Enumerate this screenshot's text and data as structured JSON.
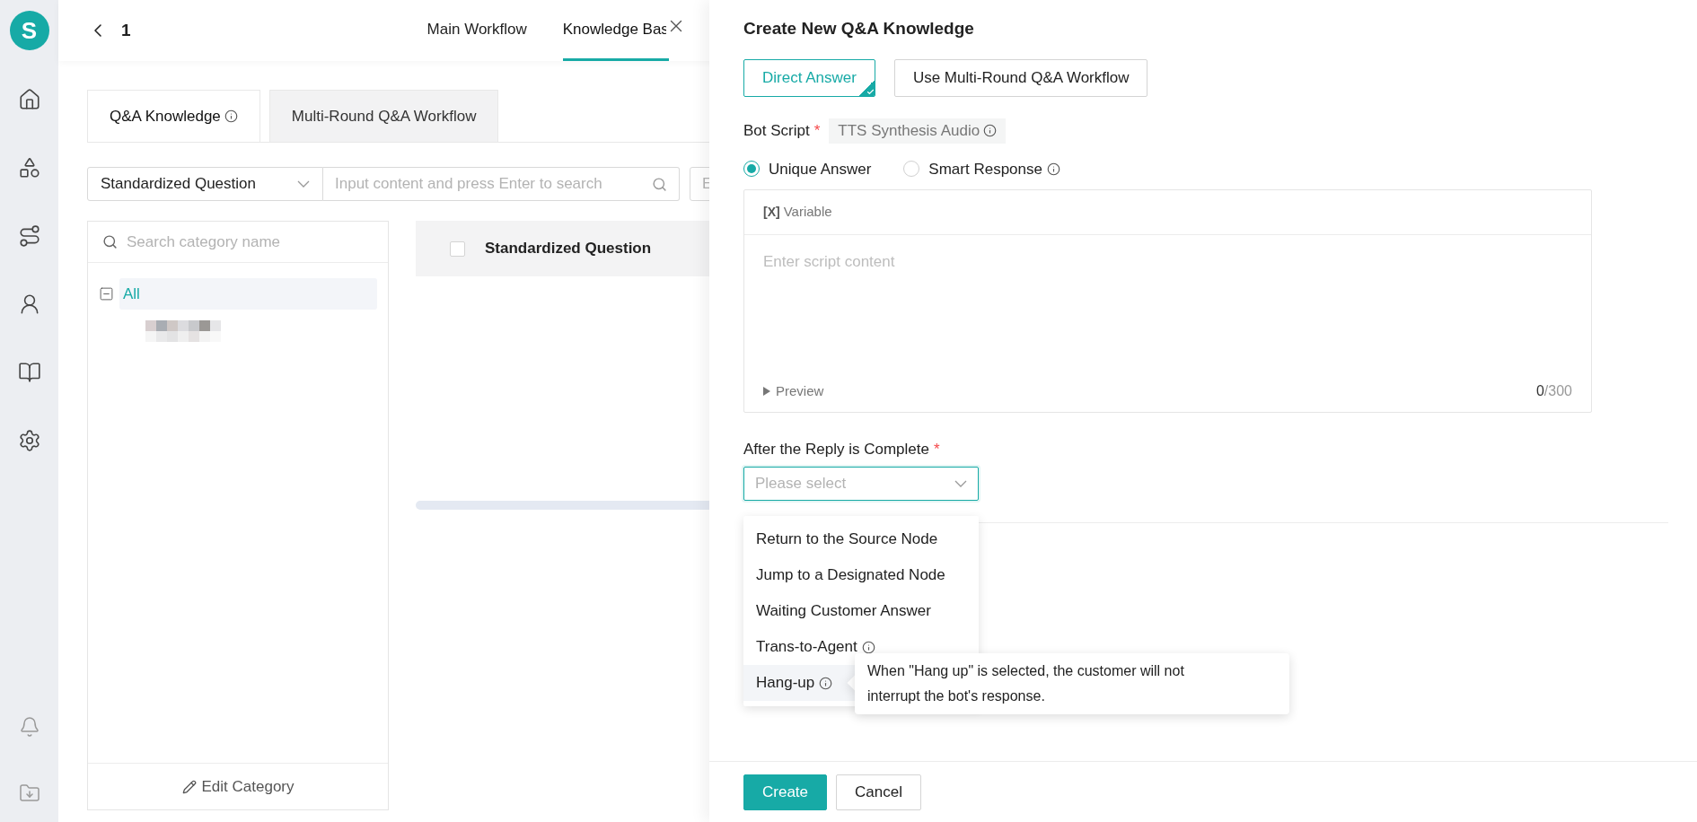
{
  "logo": {
    "letter": "S"
  },
  "header": {
    "back_label": "1",
    "tabs": [
      {
        "label": "Main Workflow",
        "selected": false
      },
      {
        "label": "Knowledge Bas",
        "selected": true
      }
    ]
  },
  "sub_tabs": [
    {
      "label": "Q&A Knowledge",
      "info": true,
      "selected": true
    },
    {
      "label": "Multi-Round Q&A Workflow",
      "info": false,
      "selected": false
    }
  ],
  "filter": {
    "field": "Standardized Question",
    "search_placeholder": "Input content and press Enter to search",
    "column_3": "E"
  },
  "category": {
    "search_placeholder": "Search category name",
    "tree": [
      {
        "label": "All",
        "expanded": true,
        "selected": true,
        "children": [
          {
            "kind": "redacted"
          }
        ]
      }
    ],
    "edit_label": "Edit Category"
  },
  "table": {
    "columns": [
      "Standardized Question"
    ],
    "select_all_checked": false
  },
  "drawer": {
    "title": "Create New Q&A Knowledge",
    "answer_types": [
      {
        "label": "Direct Answer",
        "selected": true
      },
      {
        "label": "Use Multi-Round Q&A Workflow",
        "selected": false
      }
    ],
    "bot_script": {
      "label": "Bot Script",
      "required_mark": "*",
      "tag": "TTS Synthesis Audio"
    },
    "answer_modes": [
      {
        "label": "Unique Answer",
        "info": false,
        "selected": true
      },
      {
        "label": "Smart Response",
        "info": true,
        "selected": false
      }
    ],
    "editor": {
      "toolbar_icon": "[X]",
      "toolbar": "Variable",
      "placeholder": "Enter script content",
      "preview": "Preview",
      "count": "0",
      "max": "/300"
    },
    "after_reply": {
      "label": "After the Reply is Complete",
      "required_mark": "*",
      "placeholder": "Please select",
      "options": [
        {
          "label": "Return to the Source Node",
          "info": false,
          "hovered": false
        },
        {
          "label": "Jump to a Designated Node",
          "info": false,
          "hovered": false
        },
        {
          "label": "Waiting Customer Answer",
          "info": false,
          "hovered": false
        },
        {
          "label": "Trans-to-Agent",
          "info": true,
          "hovered": false
        },
        {
          "label": "Hang-up",
          "info": true,
          "hovered": true
        }
      ]
    },
    "tooltip": "When \"Hang up\" is selected, the customer will not interrupt the bot's response.",
    "buttons": [
      {
        "label": "Create",
        "kind": "primary"
      },
      {
        "label": "Cancel",
        "kind": "default"
      }
    ]
  }
}
